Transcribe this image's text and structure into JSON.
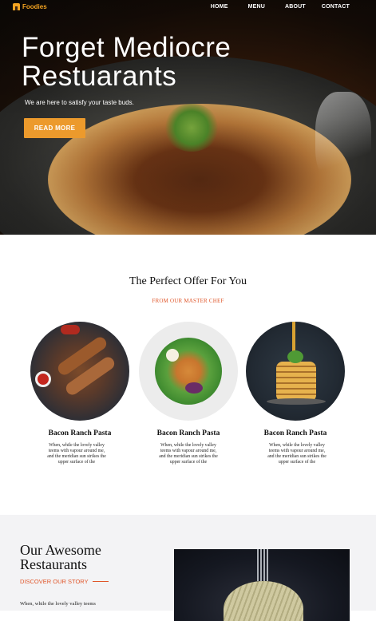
{
  "brand": {
    "name": "Foodies",
    "color": "#f3a321"
  },
  "nav": {
    "home": "HOME",
    "menu": "MENU",
    "about": "ABOUT",
    "contact": "CONTACT"
  },
  "hero": {
    "title_line1": "Forget Mediocre",
    "title_line2": "Restuarants",
    "subtitle": "We are here to satisfy your taste buds.",
    "button": "READ MORE"
  },
  "offer": {
    "title": "The Perfect Offer For You",
    "subtitle": "FROM OUR MASTER CHEF",
    "dishes": [
      {
        "name": "Bacon Ranch Pasta",
        "desc": "When, while the lovely valley teems with vapour around me, and the meridian sun strikes the upper surface of the"
      },
      {
        "name": "Bacon Ranch Pasta",
        "desc": "When, while the lovely valley teems with vapour around me, and the meridian sun strikes the upper surface of the"
      },
      {
        "name": "Bacon Ranch Pasta",
        "desc": "When, while the lovely valley teems with vapour around me, and the meridian sun strikes the upper surface of the"
      }
    ]
  },
  "story": {
    "title_line1": "Our Awesome",
    "title_line2": "Restaurants",
    "subtitle": "DISCOVER OUR STORY",
    "text": "When, while the lovely valley teems"
  },
  "colors": {
    "accent": "#ec9a2c",
    "highlight": "#e0562a",
    "story_bg": "#f3f3f5"
  }
}
